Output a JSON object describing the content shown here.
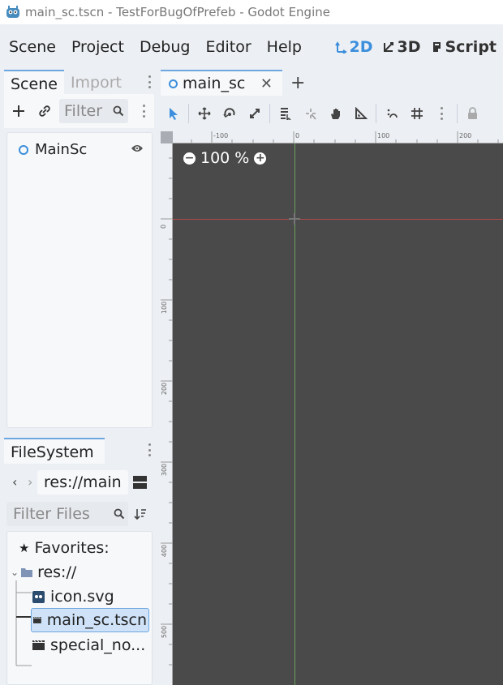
{
  "window": {
    "title": "main_sc.tscn - TestForBugOfPrefeb - Godot Engine"
  },
  "menu": {
    "items": [
      "Scene",
      "Project",
      "Debug",
      "Editor",
      "Help"
    ]
  },
  "modes": {
    "m2d": "2D",
    "m3d": "3D",
    "script": "Script",
    "active_color": "#3d8fdd"
  },
  "scene_dock": {
    "tabs": [
      "Scene",
      "Import"
    ],
    "filter_placeholder": "Filter",
    "root_node": "MainSc"
  },
  "filesystem_dock": {
    "tab": "FileSystem",
    "path": "res://main",
    "filter_placeholder": "Filter Files",
    "favorites": "Favorites:",
    "root": "res://",
    "files": [
      "icon.svg",
      "main_sc.tscn",
      "special_no..."
    ]
  },
  "editor": {
    "tab": "main_sc",
    "zoom": "100 %",
    "ruler_top": [
      "-100",
      "0",
      "100",
      "200"
    ],
    "ruler_left": [
      "0",
      "100",
      "200",
      "300",
      "400",
      "500"
    ]
  }
}
